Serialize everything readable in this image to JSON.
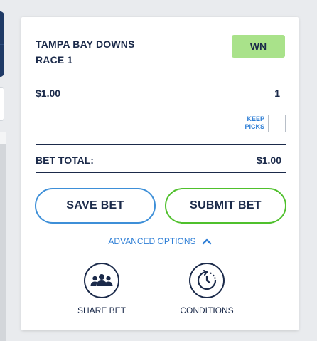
{
  "bet_slip": {
    "track_line1": "TAMPA BAY DOWNS",
    "track_line2": "RACE 1",
    "bet_type": "WN",
    "amount": "$1.00",
    "selection_count": "1",
    "keep_picks_line1": "KEEP",
    "keep_picks_line2": "PICKS",
    "bet_total_label": "BET TOTAL:",
    "bet_total_value": "$1.00"
  },
  "actions": {
    "save_label": "SAVE BET",
    "submit_label": "SUBMIT BET"
  },
  "advanced": {
    "label": "ADVANCED OPTIONS",
    "share_label": "SHARE BET",
    "conditions_label": "CONDITIONS"
  },
  "icons": {
    "advanced_toggle": "chevron-up-icon",
    "share": "group-icon",
    "conditions": "clock-icon"
  },
  "colors": {
    "navy": "#1b2a4a",
    "accent_blue": "#2f7fd6",
    "save_border": "#3d8fd8",
    "submit_border": "#4fc02c",
    "badge_bg": "#a9e28a"
  }
}
